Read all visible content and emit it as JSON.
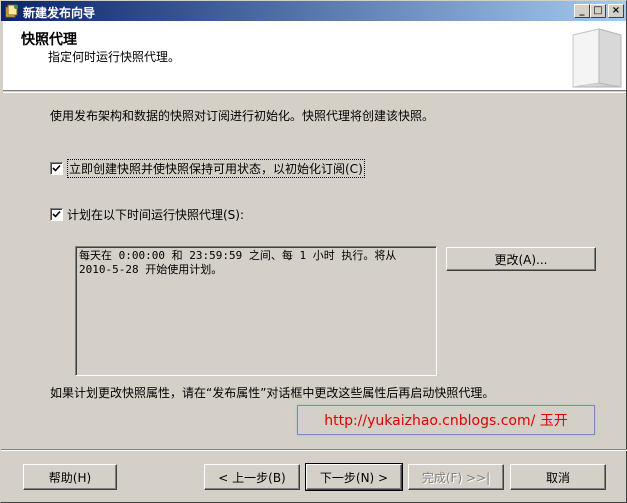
{
  "window": {
    "title": "新建发布向导",
    "min_label": "_",
    "max_label": "□",
    "close_label": "×"
  },
  "header": {
    "title": "快照代理",
    "subtitle": "指定何时运行快照代理。"
  },
  "intro_text": "使用发布架构和数据的快照对订阅进行初始化。快照代理将创建该快照。",
  "options": {
    "create_now": {
      "label": "立即创建快照并使快照保持可用状态，以初始化订阅(C)",
      "checked": true
    },
    "schedule": {
      "label": "计划在以下时间运行快照代理(S):",
      "checked": true
    }
  },
  "schedule_text_line1": "每天在 0:00:00 和 23:59:59 之间、每 1 小时 执行。将从",
  "schedule_text_line2": "2010-5-28 开始使用计划。",
  "change_button": "更改(A)...",
  "note": "如果计划更改快照属性，请在“发布属性”对话框中更改这些属性后再启动快照代理。",
  "watermark": "http://yukaizhao.cnblogs.com/ 玉开",
  "footer": {
    "help": "帮助(H)",
    "back": "< 上一步(B)",
    "next": "下一步(N) >",
    "finish": "完成(F) >>|",
    "cancel": "取消"
  },
  "colors": {
    "title_bar_start": "#0a246a",
    "title_bar_end": "#a6caf0",
    "face": "#d4d0c8",
    "watermark": "#e00000"
  }
}
